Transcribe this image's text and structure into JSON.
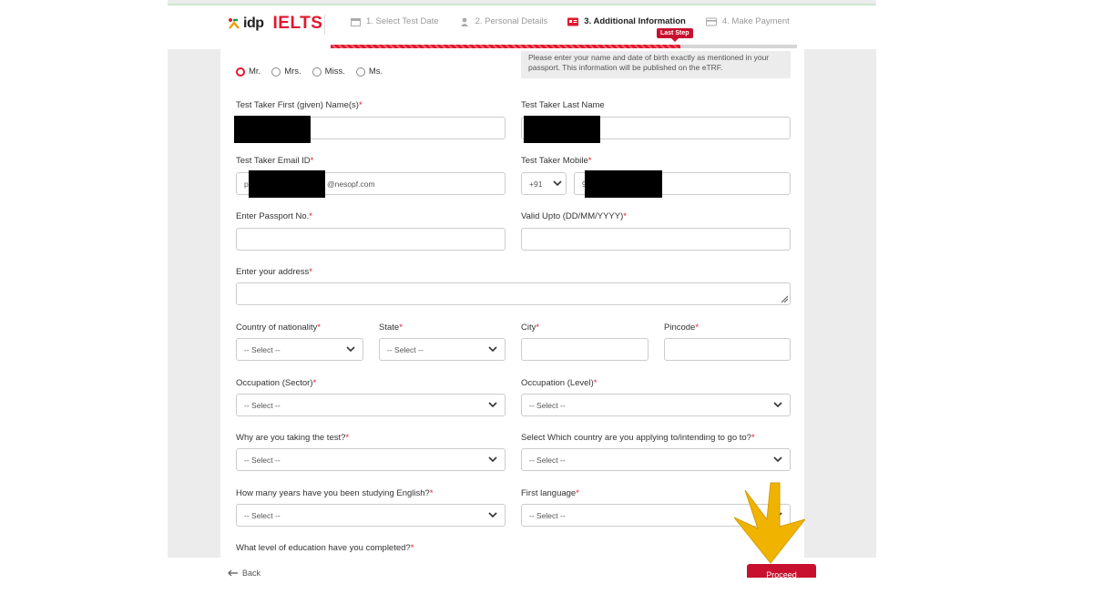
{
  "header": {
    "logo_idp": "idp",
    "logo_ielts": "IELTS",
    "steps": [
      {
        "label": "1. Select Test Date",
        "icon": "calendar-icon"
      },
      {
        "label": "2. Personal Details",
        "icon": "person-icon"
      },
      {
        "label": "3. Additional Information",
        "icon": "id-card-icon"
      },
      {
        "label": "4. Make Payment",
        "icon": "card-icon"
      }
    ],
    "last_step_badge": "Last Step",
    "progress_fraction": 0.75
  },
  "form": {
    "titles": [
      {
        "label": "Mr.",
        "selected": true
      },
      {
        "label": "Mrs.",
        "selected": false
      },
      {
        "label": "Miss.",
        "selected": false
      },
      {
        "label": "Ms.",
        "selected": false
      }
    ],
    "note_text": "Please enter your name and date of birth exactly as mentioned in your passport. This information will be published on the eTRF.",
    "first_name_label": "Test Taker First (given) Name(s)",
    "last_name_label": "Test Taker Last Name",
    "email_label": "Test Taker Email ID",
    "email_prefix": "p",
    "email_suffix": "@nesopf.com",
    "mobile_label": "Test Taker Mobile",
    "mobile_code": "+91",
    "mobile_prefix": "9",
    "passport_label": "Enter Passport No.",
    "valid_label": "Valid Upto (DD/MM/YYYY)",
    "address_label": "Enter your address",
    "nationality_label": "Country of nationality",
    "state_label": "State",
    "city_label": "City",
    "pincode_label": "Pincode",
    "occ_sector_label": "Occupation (Sector)",
    "occ_level_label": "Occupation (Level)",
    "why_label": "Why are you taking the test?",
    "country_label": "Select Which country are you applying to/intending to go to?",
    "years_label": "How many years have you been studying English?",
    "first_lang_label": "First language",
    "education_label": "What level of education have you completed?",
    "select_placeholder": "-- Select --",
    "required_mark": "*"
  },
  "footer": {
    "back_label": "Back",
    "proceed_label": "Proceed"
  },
  "colors": {
    "brand_red": "#e0192d",
    "button_red": "#c8102e",
    "annotation_arrow": "#f0b400"
  }
}
